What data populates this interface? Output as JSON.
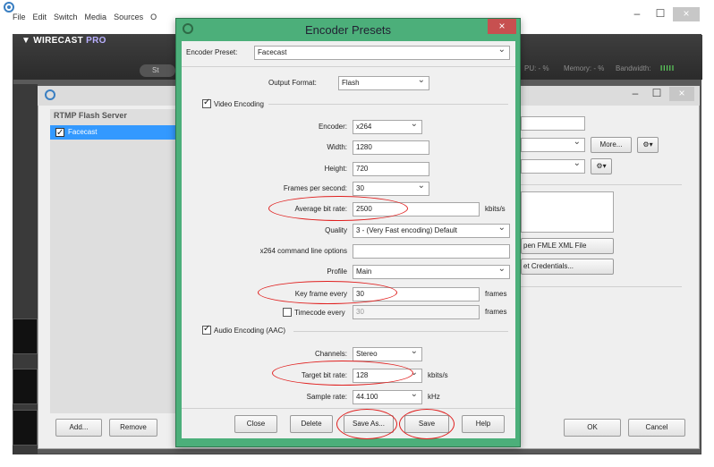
{
  "app": {
    "menu": [
      "File",
      "Edit",
      "Switch",
      "Media",
      "Sources",
      "O"
    ],
    "brand": "WIRECAST",
    "brand_suffix": "PRO",
    "stream_button": "St",
    "cpu": "PU: - %",
    "memory": "Memory: - %",
    "bandwidth": "Bandwidth:",
    "bandwidth_bars": "IIIII",
    "minimize": "–",
    "maximize": "☐",
    "close": "×"
  },
  "output_window": {
    "list_header": "RTMP Flash Server",
    "selected_item": "Facecast",
    "add_button": "Add...",
    "remove_button": "Remove",
    "more_button": "More...",
    "open_fmle": "pen FMLE XML File",
    "set_credentials": "et Credentials...",
    "ok_button": "OK",
    "cancel_button": "Cancel"
  },
  "dialog": {
    "title": "Encoder Presets",
    "close": "×",
    "preset_label": "Encoder Preset:",
    "preset_value": "Facecast",
    "output_format_label": "Output Format:",
    "output_format_value": "Flash",
    "video_encoding_label": "Video Encoding",
    "encoder_label": "Encoder:",
    "encoder_value": "x264",
    "width_label": "Width:",
    "width_value": "1280",
    "height_label": "Height:",
    "height_value": "720",
    "fps_label": "Frames per second:",
    "fps_value": "30",
    "avg_bitrate_label": "Average bit rate:",
    "avg_bitrate_value": "2500",
    "avg_bitrate_unit": "kbits/s",
    "quality_label": "Quality",
    "quality_value": "3 - (Very Fast encoding) Default",
    "cmdline_label": "x264 command line options",
    "cmdline_value": "",
    "profile_label": "Profile",
    "profile_value": "Main",
    "keyframe_label": "Key frame every",
    "keyframe_value": "30",
    "keyframe_unit": "frames",
    "timecode_label": "Timecode every",
    "timecode_value": "30",
    "timecode_unit": "frames",
    "audio_encoding_label": "Audio Encoding (AAC)",
    "channels_label": "Channels:",
    "channels_value": "Stereo",
    "target_bitrate_label": "Target bit rate:",
    "target_bitrate_value": "128",
    "target_bitrate_unit": "kbits/s",
    "sample_rate_label": "Sample rate:",
    "sample_rate_value": "44.100",
    "sample_rate_unit": "kHz",
    "buttons": {
      "close": "Close",
      "delete": "Delete",
      "save_as": "Save As...",
      "save": "Save",
      "help": "Help"
    }
  },
  "colors": {
    "dialog_frame": "#4caf7a",
    "selection": "#3399ff",
    "annotation": "#e0201f"
  }
}
